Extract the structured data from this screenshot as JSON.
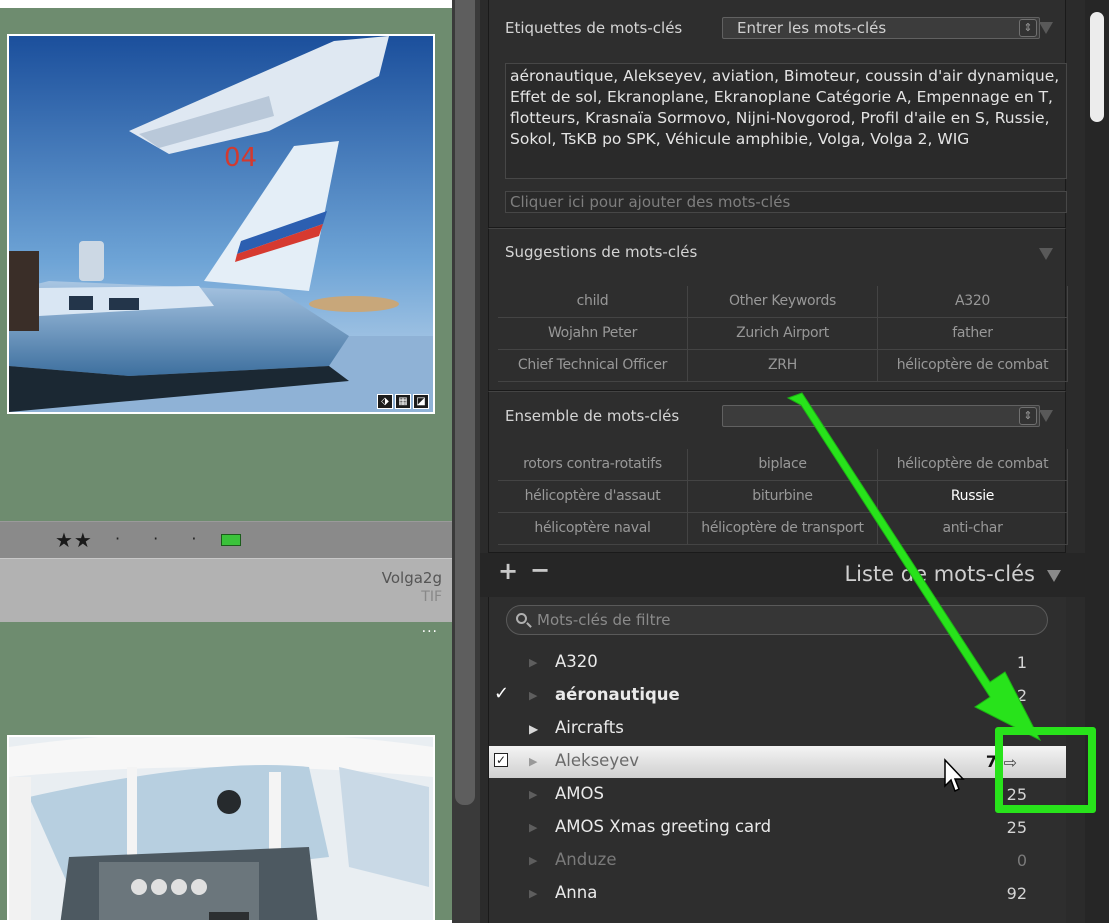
{
  "grid": {
    "rating_stars": "★★",
    "rating_dots": "· · ·",
    "color_label": "#3ac23a",
    "file_name": "Volga2g",
    "file_type": "TIF",
    "more_label": "···",
    "badges": [
      "⬗",
      "▦",
      "◪"
    ]
  },
  "keywording": {
    "title": "Etiquettes de mots-clés",
    "mode_select": "Entrer les mots-clés",
    "keywords_text": "aéronautique, Alekseyev, aviation, Bimoteur, coussin d'air dynamique, Effet de sol, Ekranoplane, Ekranoplane Catégorie A, Empennage en T, flotteurs, Krasnaïa Sormovo, Nijni-Novgorod, Profil d'aile en S, Russie, Sokol, TsKB po SPK, Véhicule amphibie, Volga, Volga 2, WIG",
    "add_placeholder": "Cliquer ici pour ajouter des mots-clés"
  },
  "suggestions": {
    "title": "Suggestions de mots-clés",
    "items": [
      "child",
      "Other Keywords",
      "A320",
      "Wojahn Peter",
      "Zurich Airport",
      "father",
      "Chief Technical Officer",
      "ZRH",
      "hélicoptère de combat"
    ]
  },
  "keyword_set": {
    "title": "Ensemble de mots-clés",
    "select_value": "",
    "items": [
      "rotors contra-rotatifs",
      "biplace",
      "hélicoptère de combat",
      "hélicoptère d'assaut",
      "biturbine",
      "Russie",
      "hélicoptère naval",
      "hélicoptère de transport",
      "anti-char"
    ],
    "highlighted": "Russie"
  },
  "keyword_list": {
    "title": "Liste de mots-clés",
    "add_label": "+",
    "remove_label": "−",
    "filter_placeholder": "Mots-clés de filtre",
    "goto_icon": "⇨",
    "rows": [
      {
        "name": "A320",
        "count": "1",
        "check": ""
      },
      {
        "name": "aéronautique",
        "count": "2",
        "check": "✓"
      },
      {
        "name": "Aircrafts",
        "count": "",
        "check": ""
      },
      {
        "name": "Alekseyev",
        "count": "7",
        "check": "☑"
      },
      {
        "name": "AMOS",
        "count": "25",
        "check": ""
      },
      {
        "name": "AMOS Xmas greeting card",
        "count": "25",
        "check": ""
      },
      {
        "name": "Anduze",
        "count": "0",
        "check": ""
      },
      {
        "name": "Anna",
        "count": "92",
        "check": ""
      }
    ]
  },
  "annotation": {
    "color": "#28e31b"
  }
}
